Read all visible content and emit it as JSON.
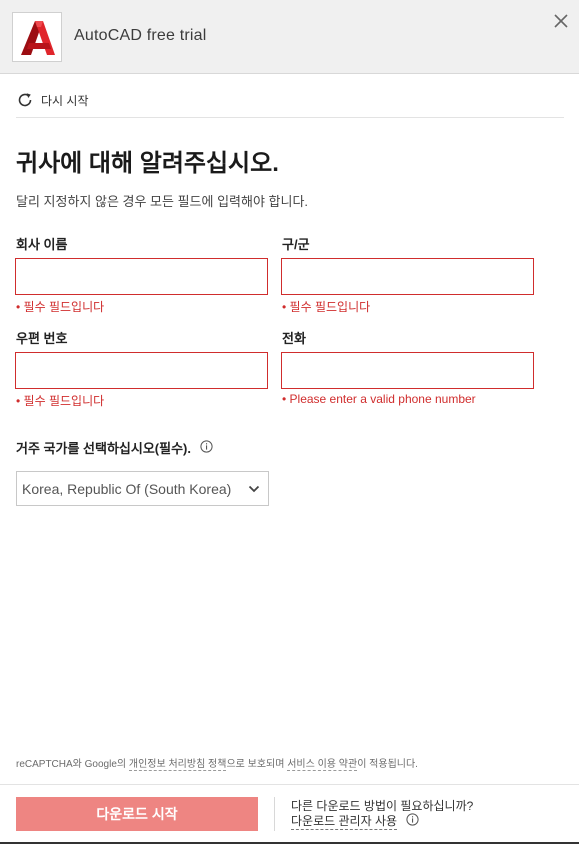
{
  "header": {
    "title": "AutoCAD free trial",
    "logo_letter": "A",
    "brand_color": "#d0121c",
    "close_icon": "close-icon"
  },
  "restart": {
    "label": "다시 시작",
    "icon": "refresh-icon"
  },
  "form": {
    "title": "귀사에 대해 알려주십시오.",
    "subtitle": "달리 지정하지 않은 경우 모든 필드에 입력해야 합니다.",
    "fields": {
      "company": {
        "label": "회사 이름",
        "value": "",
        "error": "• 필수 필드입니다"
      },
      "district": {
        "label": "구/군",
        "value": "",
        "error": "• 필수 필드입니다"
      },
      "postal": {
        "label": "우편 번호",
        "value": "",
        "error": "• 필수 필드입니다"
      },
      "phone": {
        "label": "전화",
        "value": "",
        "error": "• Please enter a valid phone number"
      }
    },
    "country": {
      "label": "거주 국가를 선택하십시오(필수).",
      "selected": "Korea, Republic Of (South Korea)"
    }
  },
  "legal": {
    "prefix": "reCAPTCHA와 Google의 ",
    "privacy_link": "개인정보 처리방침 정책",
    "middle": "으로 보호되며 ",
    "terms_link": "서비스 이용 약관",
    "suffix": "이 적용됩니다."
  },
  "footer": {
    "download_button": "다운로드 시작",
    "alt_question": "다른 다운로드 방법이 필요하십니까?",
    "alt_link": "다운로드 관리자 사용"
  },
  "colors": {
    "error": "#d02d2d",
    "button_disabled": "#ee8582",
    "header_bg": "#f0f0f0"
  }
}
